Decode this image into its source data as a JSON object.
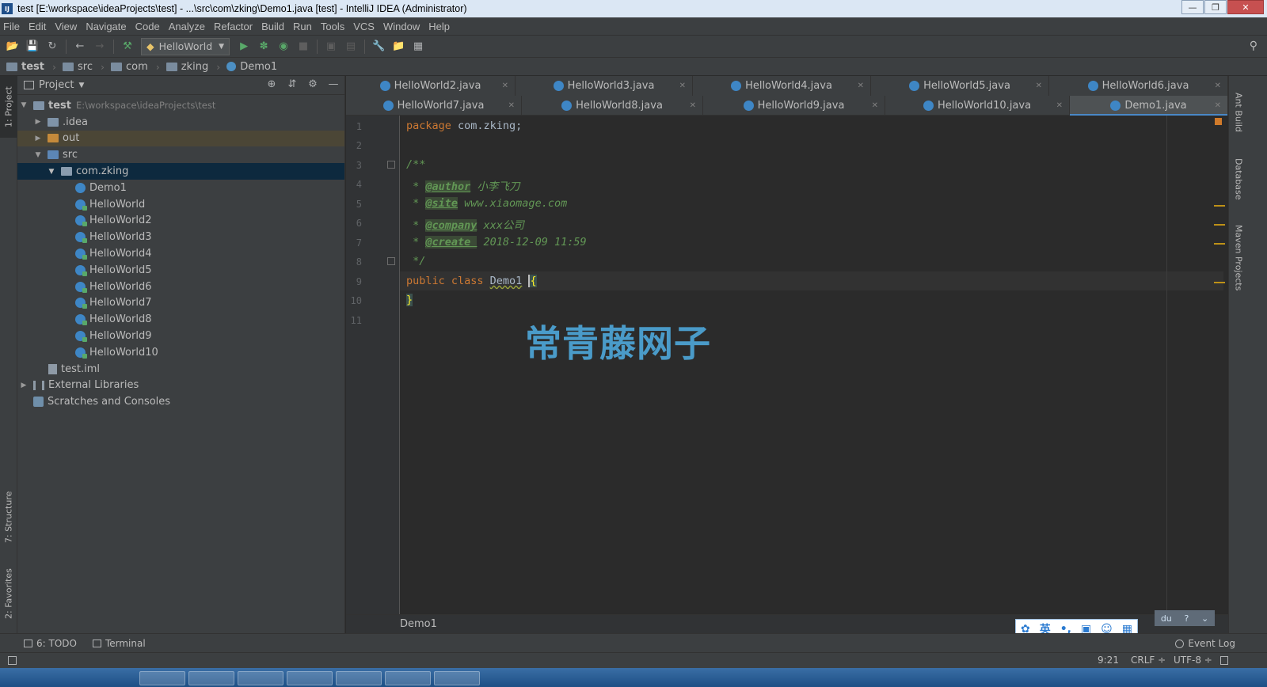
{
  "window": {
    "title": "test [E:\\workspace\\ideaProjects\\test] - ...\\src\\com\\zking\\Demo1.java [test] - IntelliJ IDEA (Administrator)",
    "app_icon": "IJ"
  },
  "menu": [
    "File",
    "Edit",
    "View",
    "Navigate",
    "Code",
    "Analyze",
    "Refactor",
    "Build",
    "Run",
    "Tools",
    "VCS",
    "Window",
    "Help"
  ],
  "toolbar": {
    "run_config": "HelloWorld"
  },
  "breadcrumb": [
    "test",
    "src",
    "com",
    "zking",
    "Demo1"
  ],
  "left_tabs": {
    "project": "1: Project",
    "structure": "7: Structure",
    "favorites": "2: Favorites"
  },
  "project_panel": {
    "title": "Project",
    "tree": {
      "root_name": "test",
      "root_path": "E:\\workspace\\ideaProjects\\test",
      "idea": ".idea",
      "out": "out",
      "src": "src",
      "package": "com.zking",
      "classes": [
        "Demo1",
        "HelloWorld",
        "HelloWorld2",
        "HelloWorld3",
        "HelloWorld4",
        "HelloWorld5",
        "HelloWorld6",
        "HelloWorld7",
        "HelloWorld8",
        "HelloWorld9",
        "HelloWorld10"
      ],
      "iml": "test.iml",
      "external": "External Libraries",
      "scratches": "Scratches and Consoles"
    }
  },
  "tabs": {
    "row1": [
      "HelloWorld2.java",
      "HelloWorld3.java",
      "HelloWorld4.java",
      "HelloWorld5.java",
      "HelloWorld6.java"
    ],
    "row2": [
      "HelloWorld7.java",
      "HelloWorld8.java",
      "HelloWorld9.java",
      "HelloWorld10.java",
      "Demo1.java"
    ],
    "active": "Demo1.java"
  },
  "editor": {
    "line_numbers": [
      "1",
      "2",
      "3",
      "4",
      "5",
      "6",
      "7",
      "8",
      "9",
      "10",
      "11"
    ],
    "code": {
      "l1_kw": "package",
      "l1_rest": " com.zking;",
      "l3": "/**",
      "l4_pre": " * ",
      "l4_tag": "@author",
      "l4_val": " 小李飞刀",
      "l5_pre": " * ",
      "l5_tag": "@site",
      "l5_val": " www.xiaomage.com",
      "l6_pre": " * ",
      "l6_tag": "@company",
      "l6_val": " xxx公司",
      "l7_pre": " * ",
      "l7_tag": "@create ",
      "l7_val": " 2018-12-09 11:59",
      "l8": " */",
      "l9_kw": "public class ",
      "l9_cls": "Demo1",
      "l9_sp": " ",
      "l9_brace": "{",
      "l10": "}"
    },
    "footer_breadcrumb": "Demo1",
    "watermark": "常青藤网子"
  },
  "right_tabs": {
    "ant": "Ant Build",
    "database": "Database",
    "maven": "Maven Projects"
  },
  "bottom_bar": {
    "todo": "6: TODO",
    "terminal": "Terminal",
    "event_log": "Event Log"
  },
  "status_bar": {
    "position": "9:21",
    "line_sep": "CRLF ÷",
    "encoding": "UTF-8 ÷"
  },
  "ime": {
    "lang": "英",
    "small_label": "du"
  },
  "colors": {
    "keyword": "#cc7832",
    "comment": "#629755",
    "selection": "#0d293e",
    "accent": "#4a88c7"
  }
}
